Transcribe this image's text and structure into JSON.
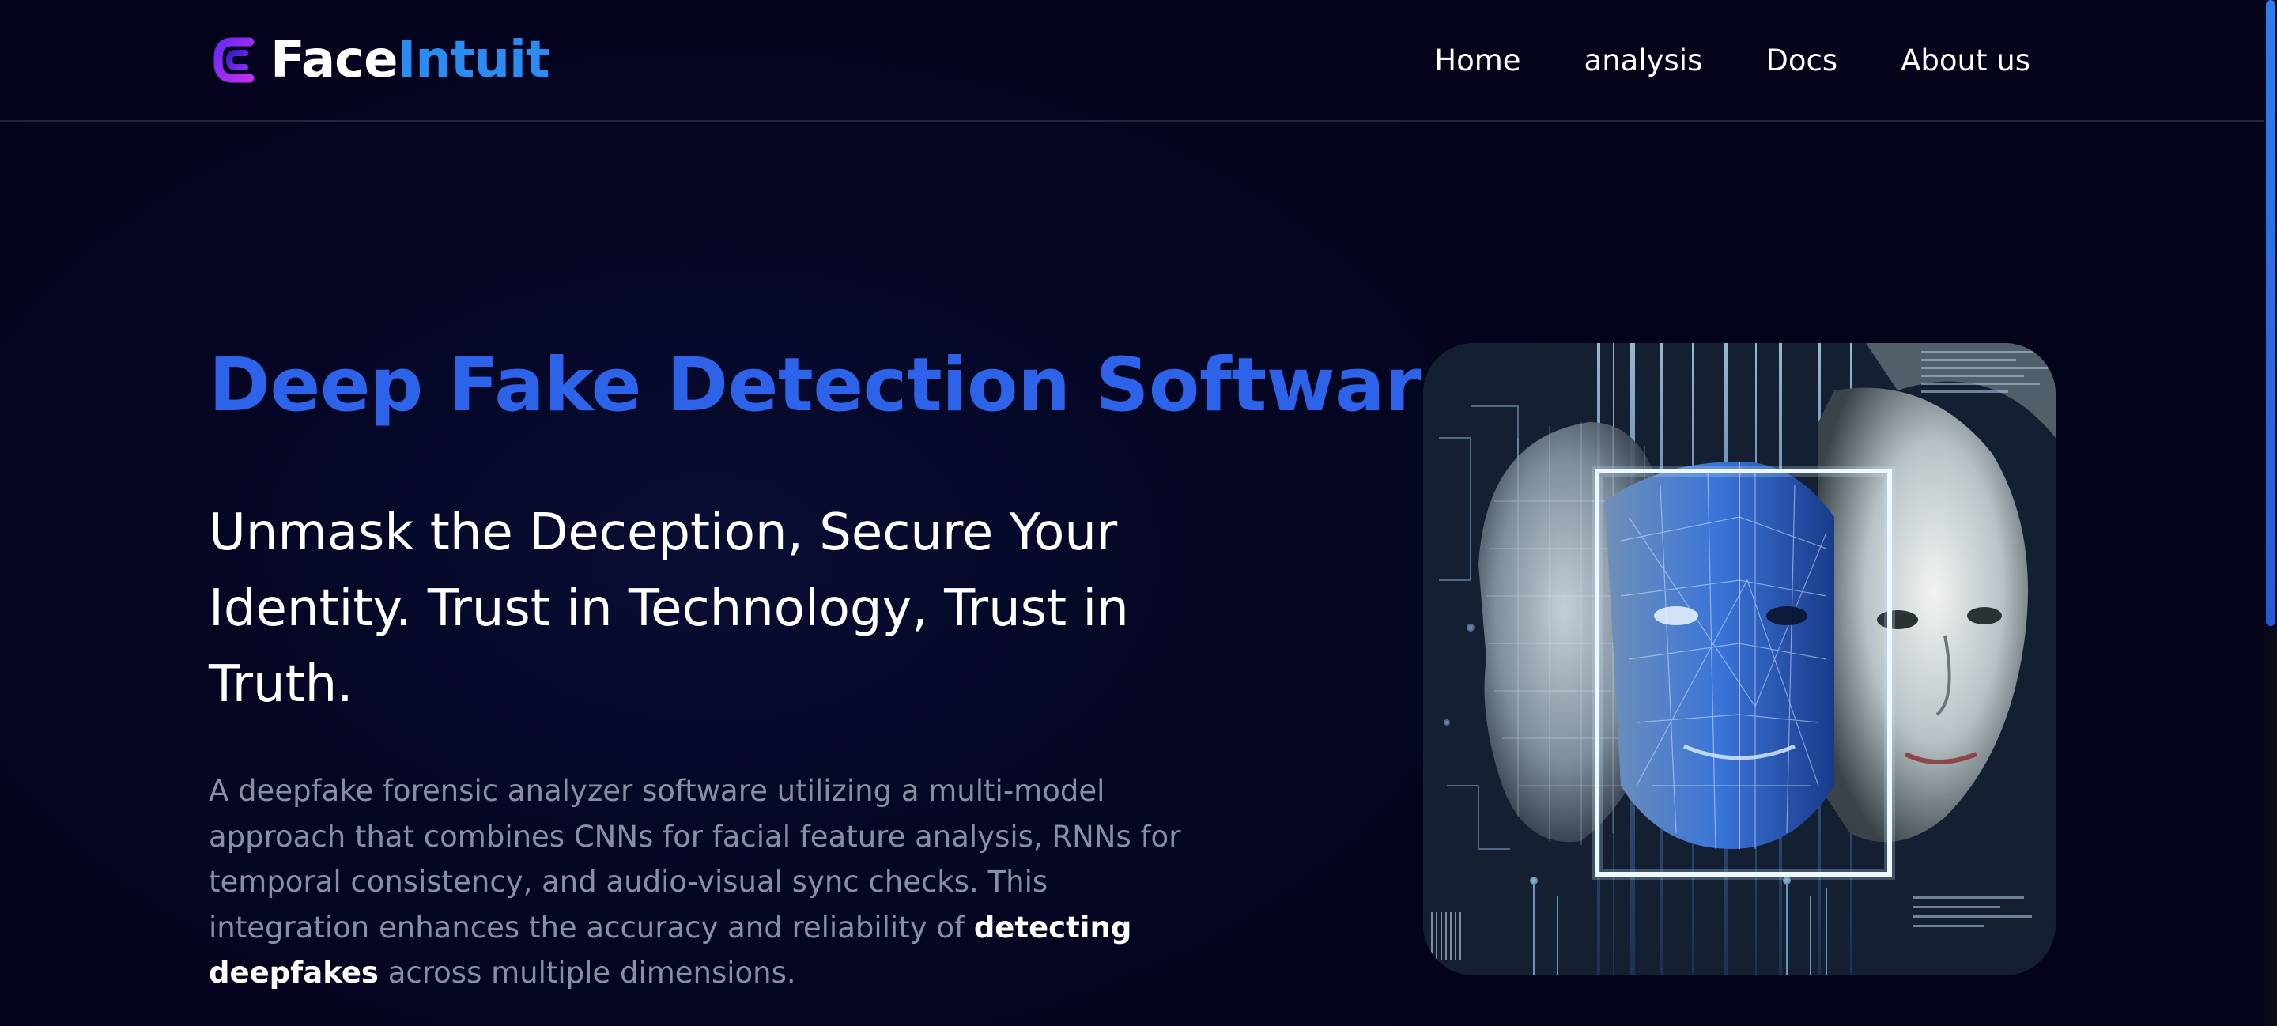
{
  "brand": {
    "name_part1": "Face",
    "name_part2": "Intuit",
    "logo_icon": "c-logo-icon",
    "colors": {
      "primary": "#2a8cf0",
      "logo_gradient": [
        "#6a2cf0",
        "#c02cf0"
      ]
    }
  },
  "nav": {
    "items": [
      {
        "label": "Home"
      },
      {
        "label": "analysis"
      },
      {
        "label": "Docs"
      },
      {
        "label": "About us"
      }
    ]
  },
  "hero": {
    "title": "Deep Fake Detection Software",
    "subtitle": "Unmask the Deception, Secure Your Identity. Trust in Technology, Trust in Truth.",
    "description_before": "A deepfake forensic analyzer software utilizing a multi-model approach that combines CNNs for facial feature analysis, RNNs for temporal consistency, and audio-visual sync checks. This integration enhances the accuracy and reliability of",
    "description_highlight": "detecting deepfakes",
    "description_after": "across multiple dimensions.",
    "image_icon": "ai-face-scan-illustration",
    "colors": {
      "title": "#2d63e8",
      "description": "#8a8ea4",
      "background": "#03031a"
    }
  }
}
